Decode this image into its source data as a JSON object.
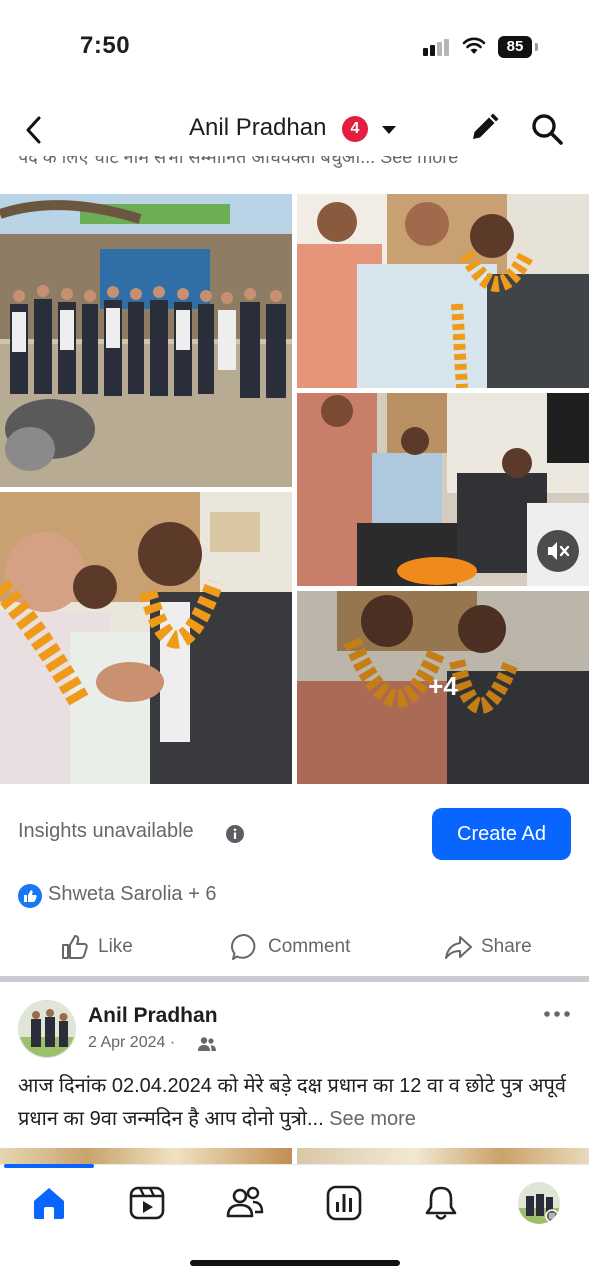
{
  "status_bar": {
    "time": "7:50",
    "battery": "85"
  },
  "header": {
    "title": "Anil Pradhan",
    "notification_count": "4"
  },
  "previous_post": {
    "truncated_text": "पद के लिए चोट नाम सभा सम्मानित अधिवक्ता बधुओ... See more",
    "photos": [
      "group-photo",
      "garland-photo-1",
      "office-photo",
      "garland-photo-2",
      "garland-photo-3"
    ],
    "more_photos": "+4",
    "insights": "Insights unavailable",
    "create_ad": "Create Ad",
    "reactions": "Shweta Sarolia + 6",
    "actions": {
      "like": "Like",
      "comment": "Comment",
      "share": "Share"
    }
  },
  "next_post": {
    "author": "Anil Pradhan",
    "date": "2 Apr 2024 ·",
    "text": "आज दिनांक 02.04.2024 को मेरे बड़े दक्ष प्रधान का 12 वा व छोटे पुत्र अपूर्व प्रधान का 9वा जन्मदिन है आप दोनो पुत्रो...",
    "see_more": "See more"
  },
  "colors": {
    "accent": "#0866ff",
    "badge": "#e41e3f",
    "secondary_text": "#65676b"
  },
  "bottom_nav": [
    "home-icon",
    "video-icon",
    "friends-icon",
    "dashboard-icon",
    "notifications-icon",
    "profile-avatar"
  ]
}
